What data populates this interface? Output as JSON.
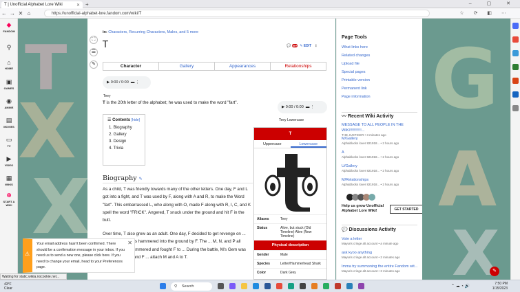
{
  "browser": {
    "tab_title": "T | Unofficial Alphabet Lore Wiki",
    "url": "https://unofficial-alphabet-lore.fandom.com/wiki/T"
  },
  "rail": {
    "items": [
      {
        "label": "FANDOM",
        "icon": "fandom-logo"
      },
      {
        "label": "",
        "icon": "search-icon"
      },
      {
        "label": "HOME",
        "icon": "home-icon"
      },
      {
        "label": "GAMES",
        "icon": "games-icon"
      },
      {
        "label": "ANIME",
        "icon": "anime-icon"
      },
      {
        "label": "MOVIES",
        "icon": "movies-icon"
      },
      {
        "label": "TV",
        "icon": "tv-icon"
      },
      {
        "label": "VIDEO",
        "icon": "video-icon"
      },
      {
        "label": "WIKIS",
        "icon": "wikis-icon"
      },
      {
        "label": "START A WIKI",
        "icon": "plus-icon"
      }
    ]
  },
  "article": {
    "cats_prefix": "in:",
    "cats": "Characters, Recurring Characters, Males,",
    "cats_more": "and 5 more",
    "title": "T",
    "comment_count": "99+",
    "edit": "EDIT",
    "tabs": [
      "Character",
      "Gallery",
      "Appearances",
      "Relationships"
    ],
    "audio1": "0:00 / 0:00",
    "audio1_caption": "Teey",
    "audio2": "0:00 / 0:00",
    "audio2_caption": "Teey Lowercase",
    "intro_bold": "T",
    "intro_rest": " is the 20th letter of the alphabet; he was used to make the word \"fart\".",
    "toc": {
      "title": "Contents",
      "hide": "[hide]",
      "items": [
        "1.  Biography",
        "2.  Gallery",
        "3.  Design",
        "4.  Trivia"
      ]
    },
    "bio_heading": "Biography",
    "bio_p1": "As a child, T was friendly towards many of the other letters. One day, F and L got into a fight, and T was used by F, along with A and R, to make the Word \"fart\". This embarrassed L, who along with O, made F along with R, I, C, and K spell the word \"FRICK\". Angered, T snuck under the ground and hit F in the butt.",
    "bio_p2": "Over time, T also grew as an adult. One day, F decided to get revenge on ... some point. T was hammered into the ground by F. The ... M, N, and P all watched T get hammered and fought F to ... During the battle, M's Gem was sucked up by F, and F ... attach M and A to T.",
    "infobox": {
      "name": "T",
      "tab1": "Uppercase",
      "tab2": "Lowercase",
      "aliases_k": "Aliases",
      "aliases_v": "Teey",
      "status_k": "Status",
      "status_v": "Alive, but stuck (Old Timeline) Alive (New Timeline)",
      "phys": "Physical description",
      "gender_k": "Gender",
      "gender_v": "Male",
      "species_k": "Species",
      "species_v": "Letter/Hammerhead Shark",
      "color_k": "Color",
      "color_v": "Dark Grey"
    }
  },
  "sidebar": {
    "tools_title": "Page Tools",
    "tools": [
      "What links here",
      "Related changes",
      "Upload file",
      "Special pages",
      "Printable version",
      "Permanent link",
      "Page information"
    ],
    "recent_title": "Recent Wiki Activity",
    "recent": [
      {
        "t": "MESSAGE TO ALL PEOPLE IN THE WIKI!!!!!!!!!!!...",
        "m": "THE JUSTICER • 3 minutes ago"
      },
      {
        "t": "M/Gallery",
        "m": "Alphablocks lover 821918... • 2 hours ago"
      },
      {
        "t": "A",
        "m": "Alphablocks lover 821918... • 2 hours ago"
      },
      {
        "t": "U/Gallery",
        "m": "Alphablocks lover 821918... • 2 hours ago"
      },
      {
        "t": "M/Relationships",
        "m": "Alphablocks lover 821918... • 2 hours ago"
      }
    ],
    "help": "Help us grow Unofficial Alphabet Lore Wiki!",
    "get_started": "GET STARTED",
    "disc_title": "Discussions Activity",
    "disc": [
      {
        "t": "Vote a letter",
        "m": "Mayuris cringe alt account • a minute ago"
      },
      {
        "t": "ask kyoo anything",
        "m": "Mayuris cringe alt account • 2 minutes ago"
      },
      {
        "t": "Imma try summoning the entire Fandom wit...",
        "m": "Mayuris cringe alt account • 3 minutes ago"
      }
    ]
  },
  "notice": "Your email address hasn't been confirmed. There should be a confirmation message in your inbox. If you need us to send a new one, please click here. If you need to change your email, head to your Preferences page.",
  "status_bar": "Waiting for static.wikia.nocookie.net...",
  "taskbar": {
    "temp": "43°F",
    "weather": "Clear",
    "search": "Search",
    "time": "7:50 PM",
    "date": "1/15/2023"
  },
  "colors": {
    "accent": "#cc0000",
    "link": "#3366cc",
    "notice": "#ff9f1c"
  }
}
